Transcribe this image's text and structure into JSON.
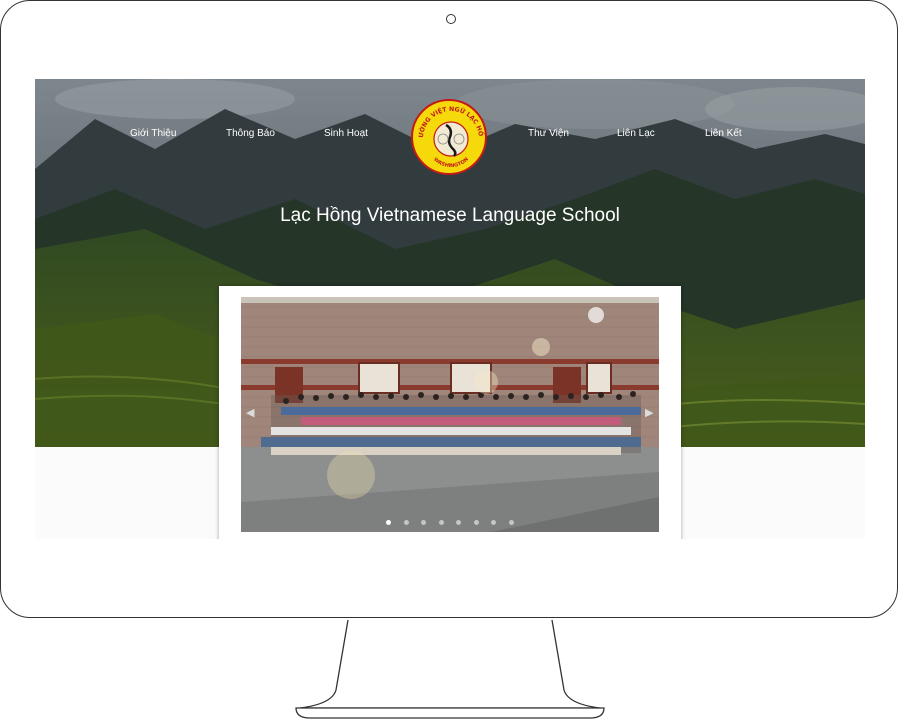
{
  "site": {
    "title": "Lạc Hồng Vietnamese Language School",
    "logo": {
      "top_text": "TRƯỜNG VIỆT NGỮ LẠC HỒNG",
      "bottom_text": "WASHINGTON"
    }
  },
  "nav": {
    "left": [
      {
        "label": "Giới Thiệu"
      },
      {
        "label": "Thông Báo"
      },
      {
        "label": "Sinh Hoạt"
      }
    ],
    "right": [
      {
        "label": "Thư Viện"
      },
      {
        "label": "Liên Lạc"
      },
      {
        "label": "Liên Kết"
      }
    ]
  },
  "slider": {
    "prev_icon": "chevron-left-icon",
    "next_icon": "chevron-right-icon",
    "slide_count": 8,
    "active_index": 0
  },
  "colors": {
    "logo_yellow": "#f5d90a",
    "logo_red": "#c21a17",
    "nav_text": "#ffffff"
  }
}
